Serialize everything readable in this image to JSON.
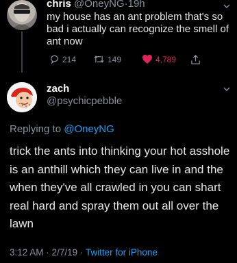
{
  "tweet": {
    "display_name": "chris",
    "handle": "@OneyNG",
    "separator": "·",
    "time": "19h",
    "text": "my house has an ant problem that's so bad i actually can recognize the smell of ant now",
    "reply_count": "214",
    "retweet_count": "149",
    "like_count": "4,789",
    "icons": [
      "reply-icon",
      "retweet-icon",
      "heart-icon",
      "share-icon",
      "chevron-down-icon"
    ],
    "colors": {
      "like": "#e0245e",
      "link": "#1da1f2",
      "muted": "#8a9298"
    }
  },
  "reply": {
    "display_name": "zach",
    "handle": "@psychicpebble",
    "replying_prefix": "Replying to",
    "replying_to": "@OneyNG",
    "text": "trick the ants into thinking your hot asshole is an anthill which they can live in and the when they've all crawled in you can shart real hard and spray them out all over the lawn",
    "time": "3:12 AM",
    "separator": "·",
    "date": "2/7/19",
    "separator2": "·",
    "source": "Twitter for iPhone"
  }
}
